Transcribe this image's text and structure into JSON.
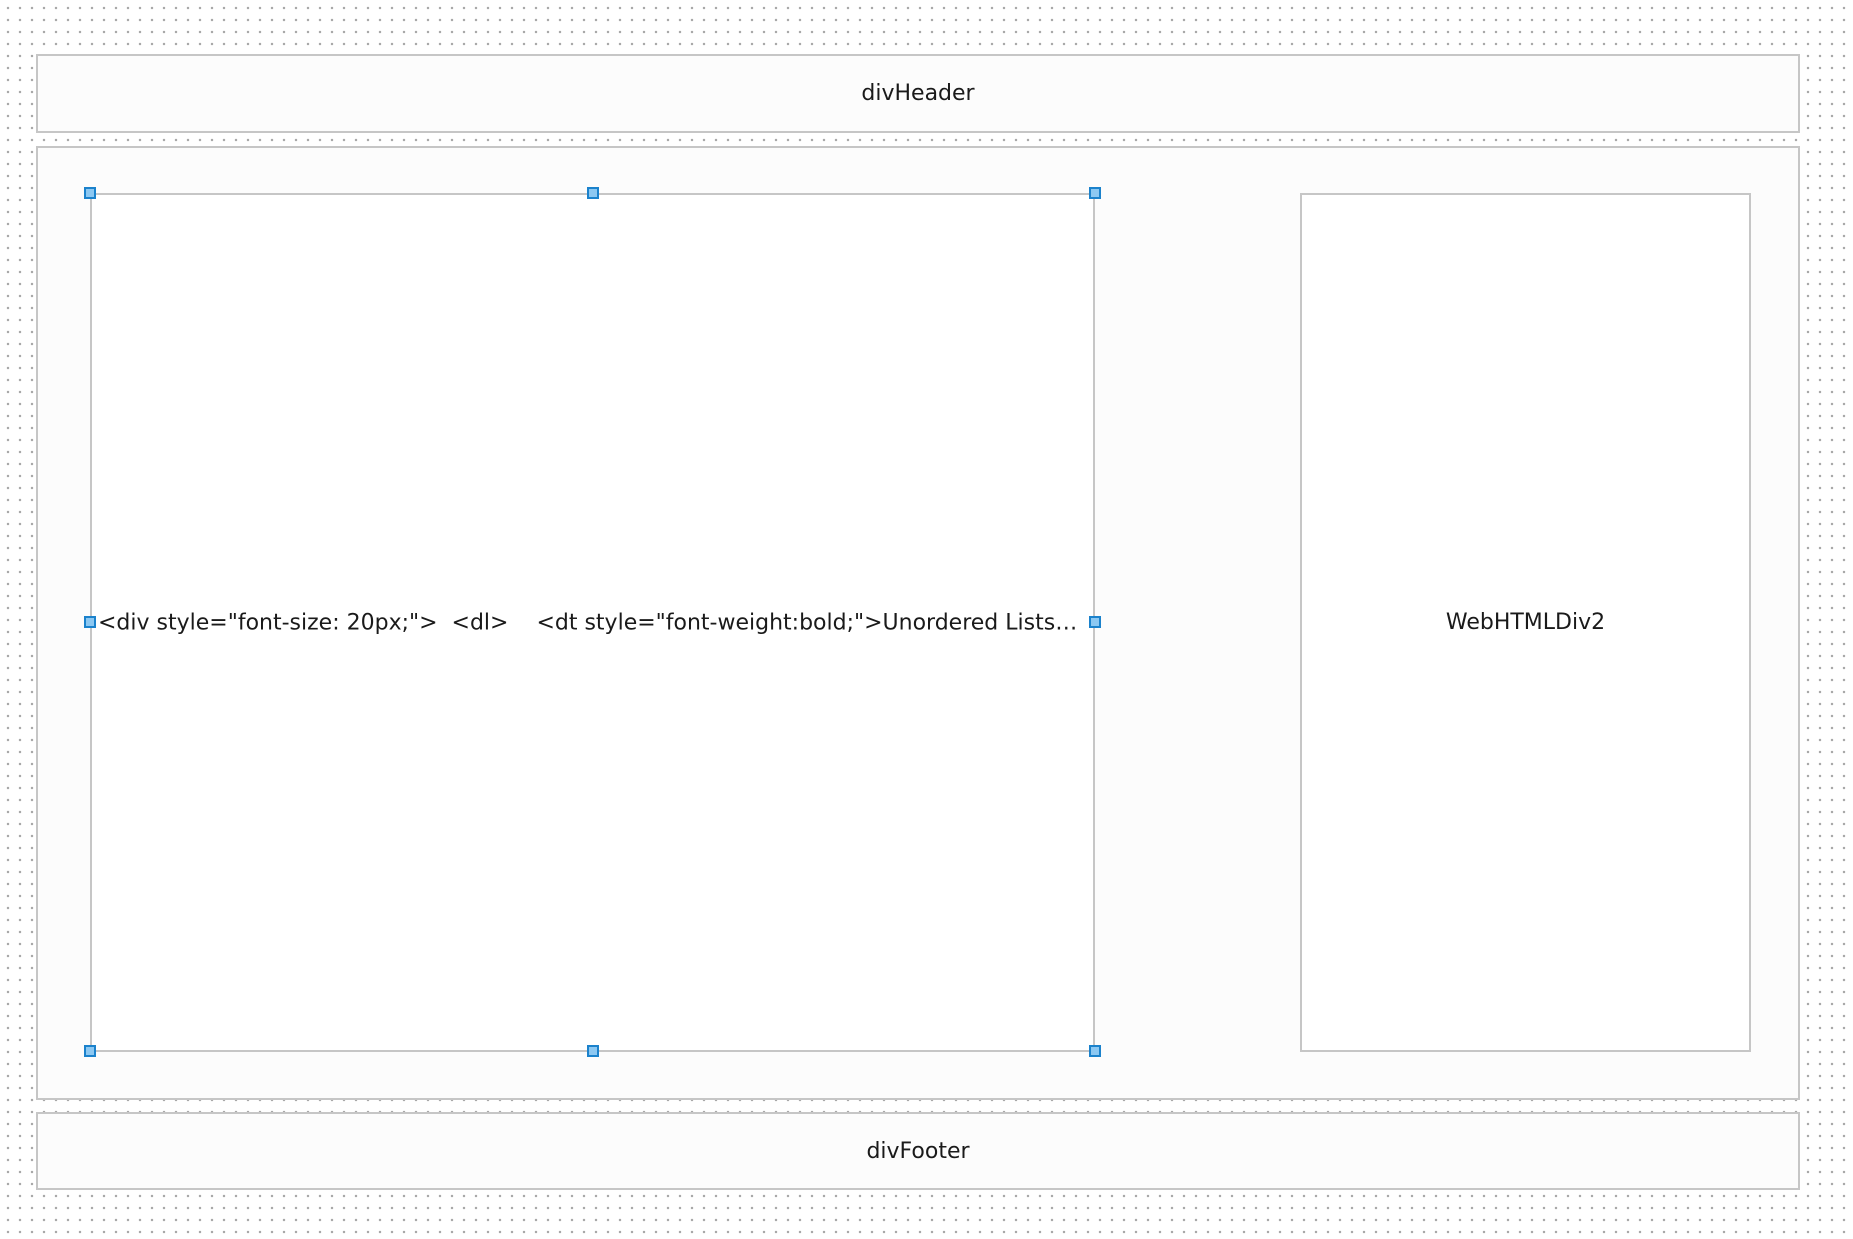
{
  "designer": {
    "header_label": "divHeader",
    "content_label": "",
    "footer_label": "divFooter",
    "html_div_1": {
      "caption": "<div style=\"font-size: 20px;\">  <dl>    <dt style=\"font-weight:bold;\">Unordered Lists</dt>    <dd s...",
      "selected": true
    },
    "html_div_2": {
      "caption": "WebHTMLDiv2",
      "selected": false
    }
  },
  "colors": {
    "canvas_dot": "#a9a9a9",
    "panel_border": "#c6c6c6",
    "handle_fill": "#8cc8f2",
    "handle_border": "#1b82cc"
  }
}
